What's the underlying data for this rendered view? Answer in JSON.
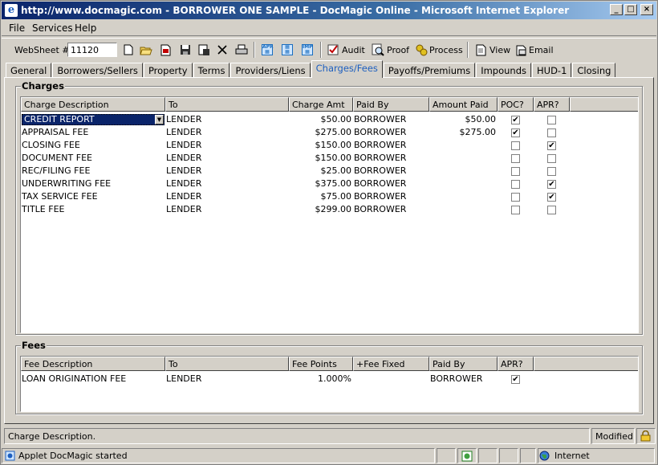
{
  "window": {
    "title": "http://www.docmagic.com - BORROWER ONE SAMPLE - DocMagic Online - Microsoft Internet Explorer",
    "minimize": "_",
    "maximize": "□",
    "close": "×"
  },
  "menu": [
    "File",
    "Services",
    "Help"
  ],
  "toolbar": {
    "websheet_label": "WebSheet #",
    "websheet_value": "11120",
    "audit": "Audit",
    "proof": "Proof",
    "process": "Process",
    "view": "View",
    "email": "Email"
  },
  "tabs": [
    "General",
    "Borrowers/Sellers",
    "Property",
    "Terms",
    "Providers/Liens",
    "Charges/Fees",
    "Payoffs/Premiums",
    "Impounds",
    "HUD-1",
    "Closing"
  ],
  "active_tab": "Charges/Fees",
  "charges": {
    "title": "Charges",
    "headers": [
      "Charge Description",
      "To",
      "Charge Amt",
      "Paid By",
      "Amount Paid",
      "POC?",
      "APR?"
    ],
    "rows": [
      {
        "desc": "CREDIT REPORT",
        "to": "LENDER",
        "amt": "$50.00",
        "paid_by": "BORROWER",
        "amount_paid": "$50.00",
        "poc": true,
        "apr": false
      },
      {
        "desc": "APPRAISAL FEE",
        "to": "LENDER",
        "amt": "$275.00",
        "paid_by": "BORROWER",
        "amount_paid": "$275.00",
        "poc": true,
        "apr": false
      },
      {
        "desc": "CLOSING FEE",
        "to": "LENDER",
        "amt": "$150.00",
        "paid_by": "BORROWER",
        "amount_paid": "",
        "poc": false,
        "apr": true
      },
      {
        "desc": "DOCUMENT FEE",
        "to": "LENDER",
        "amt": "$150.00",
        "paid_by": "BORROWER",
        "amount_paid": "",
        "poc": false,
        "apr": false
      },
      {
        "desc": "REC/FILING FEE",
        "to": "LENDER",
        "amt": "$25.00",
        "paid_by": "BORROWER",
        "amount_paid": "",
        "poc": false,
        "apr": false
      },
      {
        "desc": "UNDERWRITING FEE",
        "to": "LENDER",
        "amt": "$375.00",
        "paid_by": "BORROWER",
        "amount_paid": "",
        "poc": false,
        "apr": true
      },
      {
        "desc": "TAX SERVICE FEE",
        "to": "LENDER",
        "amt": "$75.00",
        "paid_by": "BORROWER",
        "amount_paid": "",
        "poc": false,
        "apr": true
      },
      {
        "desc": "TITLE FEE",
        "to": "LENDER",
        "amt": "$299.00",
        "paid_by": "BORROWER",
        "amount_paid": "",
        "poc": false,
        "apr": false
      }
    ]
  },
  "fees": {
    "title": "Fees",
    "headers": [
      "Fee Description",
      "To",
      "Fee Points",
      "+Fee Fixed",
      "Paid By",
      "APR?"
    ],
    "rows": [
      {
        "desc": "LOAN ORIGINATION FEE",
        "to": "LENDER",
        "points": "1.000%",
        "fixed": "",
        "paid_by": "BORROWER",
        "apr": true
      }
    ]
  },
  "status": {
    "message": "Charge Description.",
    "state": "Modified",
    "applet": "Applet DocMagic started",
    "zone": "Internet"
  }
}
